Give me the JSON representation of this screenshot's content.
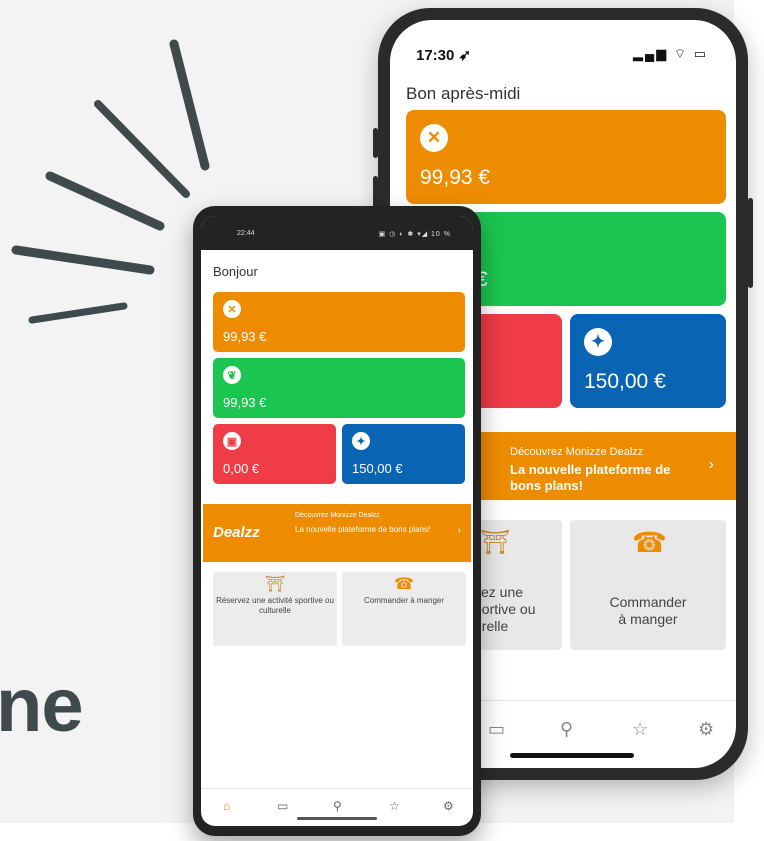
{
  "headline_fragment": "ne",
  "colors": {
    "orange": "#ee8c00",
    "green": "#1cc450",
    "red": "#f03c46",
    "blue": "#0a64b4",
    "nav_active": "#ee8c00"
  },
  "iphone": {
    "status_time": "17:30",
    "status_icons": "signal wifi battery",
    "greeting": "Bon après-midi",
    "cards": [
      {
        "amount": "99,93 €",
        "icon": "fork-knife-icon"
      },
      {
        "amount": "€",
        "icon": "leaf-icon"
      },
      {
        "amount": "",
        "icon": "gift-icon"
      },
      {
        "amount": "150,00 €",
        "icon": "person-icon"
      }
    ],
    "promo": {
      "small": "Découvrez Monizze Dealzz",
      "big": "La nouvelle plateforme de bons plans!",
      "chevron": "›"
    },
    "tiles": [
      {
        "label": "vez une\nportive ou\nurelle"
      },
      {
        "label": "Commander\nà manger"
      }
    ],
    "nav": [
      "card-icon",
      "search-icon",
      "star-icon",
      "settings-icon"
    ]
  },
  "android": {
    "status_time": "22:44",
    "status_icons": "▣ ◷ ◐ ✱ ▾◢ 10 %",
    "greeting": "Bonjour",
    "cards": [
      {
        "amount": "99,93 €",
        "icon": "fork-knife-icon"
      },
      {
        "amount": "99,93 €",
        "icon": "leaf-icon"
      },
      {
        "amount": "0,00 €",
        "icon": "gift-icon"
      },
      {
        "amount": "150,00 €",
        "icon": "person-icon"
      }
    ],
    "promo": {
      "logo": "Dealzz",
      "small": "Découvrez Monizze Dealzz",
      "big": "La nouvelle plateforme de bons plans!",
      "chevron": "›"
    },
    "tiles": [
      {
        "label": "Réservez une activité sportive ou culturelle"
      },
      {
        "label": "Commander à manger"
      }
    ],
    "nav": [
      "home-icon",
      "card-icon",
      "search-icon",
      "star-icon",
      "settings-icon"
    ]
  }
}
